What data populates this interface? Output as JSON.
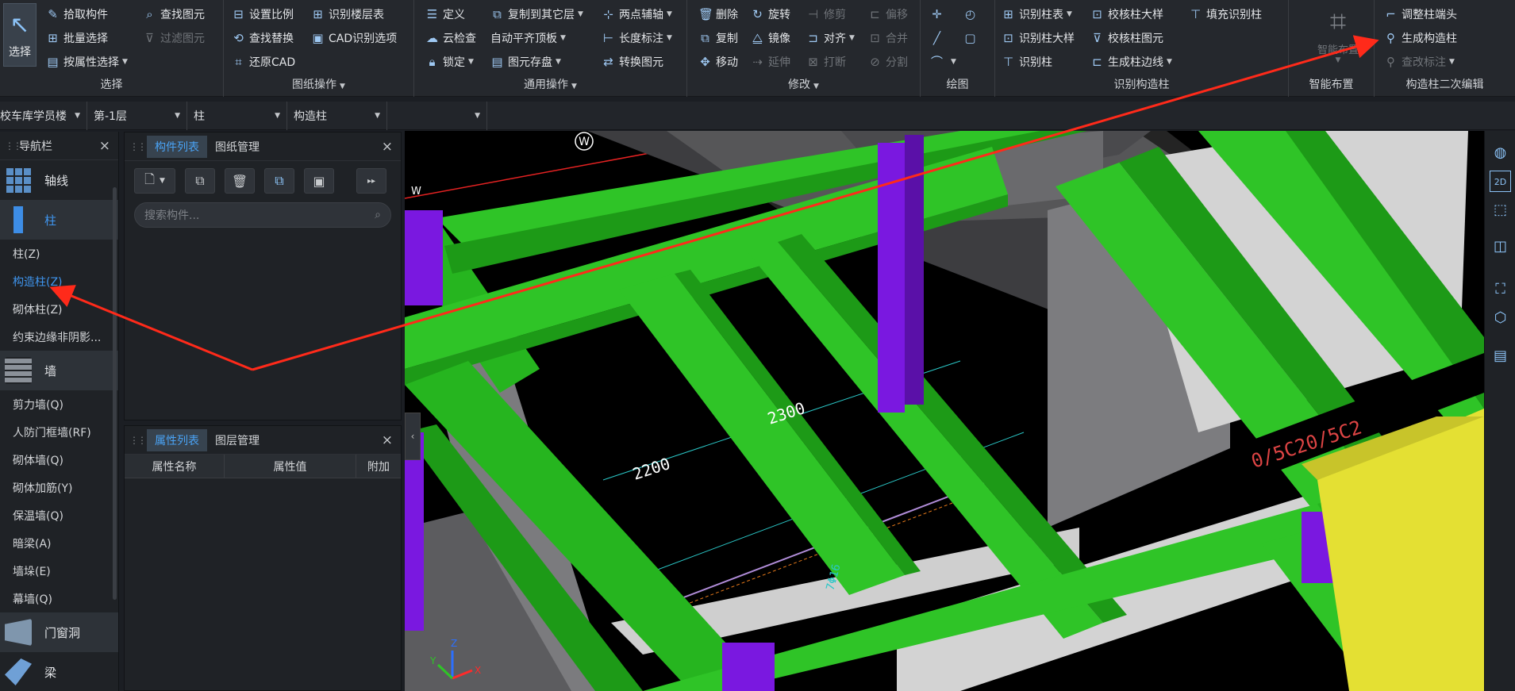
{
  "ribbon": {
    "select": {
      "big_label": "选择",
      "pick": "拾取构件",
      "batch": "批量选择",
      "by_attr": "按属性选择",
      "find": "查找图元",
      "filter": "过滤图元",
      "group_label": "选择"
    },
    "drawing_ops": {
      "set_scale": "设置比例",
      "recognize_floor_table": "识别楼层表",
      "find_replace": "查找替换",
      "cad_options": "CAD识别选项",
      "restore_cad": "还原CAD",
      "group_label": "图纸操作"
    },
    "general_ops": {
      "define": "定义",
      "copy_to_floor": "复制到其它层",
      "two_point_axis": "两点辅轴",
      "cloud_check": "云检查",
      "auto_align": "自动平齐顶板",
      "length_dim": "长度标注",
      "lock": "锁定",
      "store_element": "图元存盘",
      "convert_element": "转换图元",
      "group_label": "通用操作"
    },
    "modify": {
      "delete": "删除",
      "rotate": "旋转",
      "trim": "修剪",
      "offset": "偏移",
      "copy": "复制",
      "mirror": "镜像",
      "align": "对齐",
      "merge": "合并",
      "move": "移动",
      "extend": "延伸",
      "break": "打断",
      "split": "分割",
      "group_label": "修改"
    },
    "draw": {
      "group_label": "绘图"
    },
    "recognize_column": {
      "recognize_column_table": "识别柱表",
      "check_column_detail": "校核柱大样",
      "fill_recognize_column": "填充识别柱",
      "recognize_column_detail": "识别柱大样",
      "check_column_element": "校核柱图元",
      "recognize_column": "识别柱",
      "gen_column_edge": "生成柱边线",
      "group_label": "识别构造柱"
    },
    "smart": {
      "label": "智能布置",
      "group_label": "智能布置"
    },
    "secondary": {
      "adjust_column_end": "调整柱端头",
      "gen_construction_column": "生成构造柱",
      "check_annotation": "查改标注",
      "group_label": "构造柱二次编辑"
    }
  },
  "floorbar": {
    "project": "校车库学员楼",
    "floor": "第-1层",
    "category": "柱",
    "component": "构造柱",
    "extra": ""
  },
  "nav": {
    "title": "导航栏",
    "categories": [
      {
        "label": "轴线",
        "color": "#5a8fc7"
      },
      {
        "label": "柱",
        "color": "#3d8de6"
      },
      {
        "label": "墙",
        "color": "#8b9199"
      },
      {
        "label": "门窗洞",
        "color": "#7f96ad"
      },
      {
        "label": "梁",
        "color": "#6fa0d6"
      }
    ],
    "column_items": [
      "柱(Z)",
      "构造柱(Z)",
      "砌体柱(Z)",
      "约束边缘非阴影..."
    ],
    "wall_items": [
      "剪力墙(Q)",
      "人防门框墙(RF)",
      "砌体墙(Q)",
      "砌体加筋(Y)",
      "保温墙(Q)",
      "暗梁(A)",
      "墙垛(E)",
      "幕墙(Q)"
    ]
  },
  "component_panel": {
    "tab_list": "构件列表",
    "tab_drawings": "图纸管理",
    "search_placeholder": "搜索构件..."
  },
  "property_panel": {
    "tab_props": "属性列表",
    "tab_layers": "图层管理",
    "col_name": "属性名称",
    "col_value": "属性值",
    "col_extra": "附加"
  },
  "viewport": {
    "axis_label": "W",
    "axis_label_2": "W",
    "dim_1": "2200",
    "dim_2": "2300",
    "dim_3": "7Φ16",
    "rebar_text": "0/5C20/5C2",
    "gizmo_x": "X",
    "gizmo_y": "Y",
    "gizmo_z": "Z"
  },
  "colors": {
    "accent": "#3f95ee",
    "beam_green": "#26b51f",
    "column_purple": "#7a18e0",
    "slab_yellow": "#e4e033",
    "arrow_red": "#ff2a1a"
  }
}
